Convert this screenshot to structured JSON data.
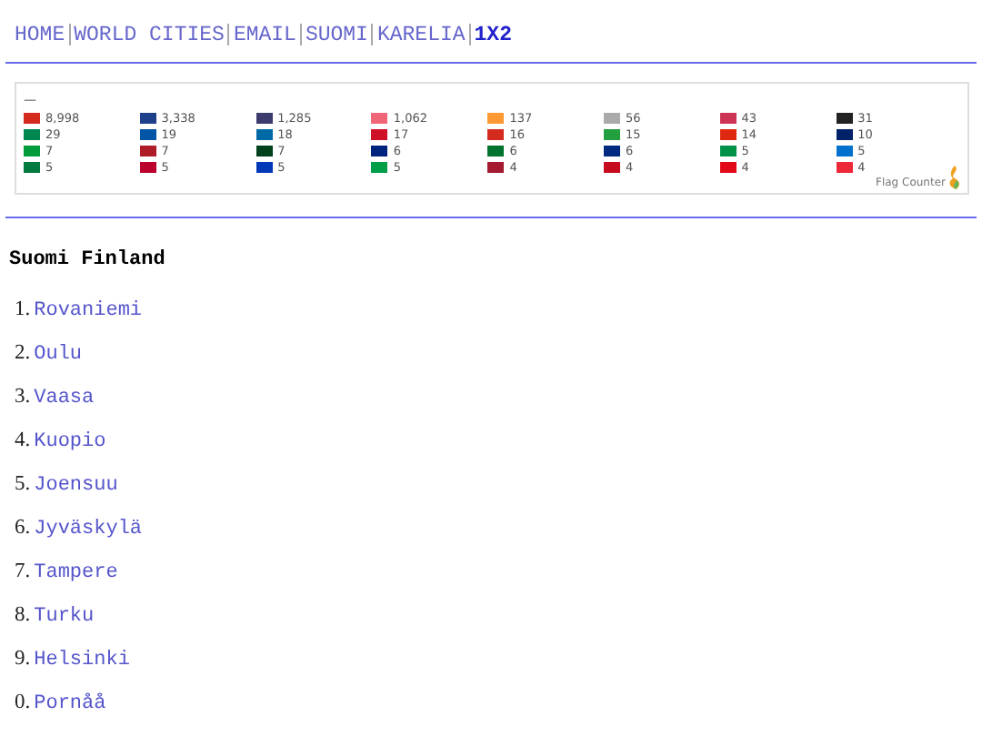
{
  "nav": [
    {
      "label": "HOME",
      "selected": false
    },
    {
      "label": "WORLD CITIES",
      "selected": false
    },
    {
      "label": "EMAIL",
      "selected": false
    },
    {
      "label": "SUOMI",
      "selected": false
    },
    {
      "label": "KARELIA",
      "selected": false
    },
    {
      "label": "1X2",
      "selected": true
    }
  ],
  "flag_counter": {
    "dash": "—",
    "brand": "Flag Counter",
    "entries": [
      {
        "count": "8,998",
        "color": "#d52b1e"
      },
      {
        "count": "3,338",
        "color": "#1e3f8a"
      },
      {
        "count": "1,285",
        "color": "#3c3b6e"
      },
      {
        "count": "1,062",
        "color": "#ee6677"
      },
      {
        "count": "137",
        "color": "#ff9933"
      },
      {
        "count": "56",
        "color": "#aaaaaa"
      },
      {
        "count": "43",
        "color": "#cc3355"
      },
      {
        "count": "31",
        "color": "#222222"
      },
      {
        "count": "29",
        "color": "#008751"
      },
      {
        "count": "19",
        "color": "#0055a4"
      },
      {
        "count": "18",
        "color": "#006aa7"
      },
      {
        "count": "17",
        "color": "#ce1126"
      },
      {
        "count": "16",
        "color": "#d52b1e"
      },
      {
        "count": "15",
        "color": "#239f40"
      },
      {
        "count": "14",
        "color": "#de2910"
      },
      {
        "count": "10",
        "color": "#012169"
      },
      {
        "count": "7",
        "color": "#009c3b"
      },
      {
        "count": "7",
        "color": "#ae1c28"
      },
      {
        "count": "7",
        "color": "#01411c"
      },
      {
        "count": "6",
        "color": "#00247d"
      },
      {
        "count": "6",
        "color": "#00732f"
      },
      {
        "count": "6",
        "color": "#002b7f"
      },
      {
        "count": "5",
        "color": "#009246"
      },
      {
        "count": "5",
        "color": "#0072ce"
      },
      {
        "count": "5",
        "color": "#007a3d"
      },
      {
        "count": "5",
        "color": "#bc002d"
      },
      {
        "count": "5",
        "color": "#0038b8"
      },
      {
        "count": "5",
        "color": "#009e49"
      },
      {
        "count": "4",
        "color": "#a51931"
      },
      {
        "count": "4",
        "color": "#c60b1e"
      },
      {
        "count": "4",
        "color": "#e30a17"
      },
      {
        "count": "4",
        "color": "#ed2939"
      }
    ]
  },
  "heading": "Suomi Finland",
  "cities": [
    {
      "number": "1.",
      "name": "Rovaniemi"
    },
    {
      "number": "2.",
      "name": "Oulu"
    },
    {
      "number": "3.",
      "name": "Vaasa"
    },
    {
      "number": "4.",
      "name": "Kuopio"
    },
    {
      "number": "5.",
      "name": "Joensuu"
    },
    {
      "number": "6.",
      "name": "Jyväskylä"
    },
    {
      "number": "7.",
      "name": "Tampere"
    },
    {
      "number": "8.",
      "name": "Turku"
    },
    {
      "number": "9.",
      "name": "Helsinki"
    },
    {
      "number": "0.",
      "name": "Pornåå"
    }
  ]
}
